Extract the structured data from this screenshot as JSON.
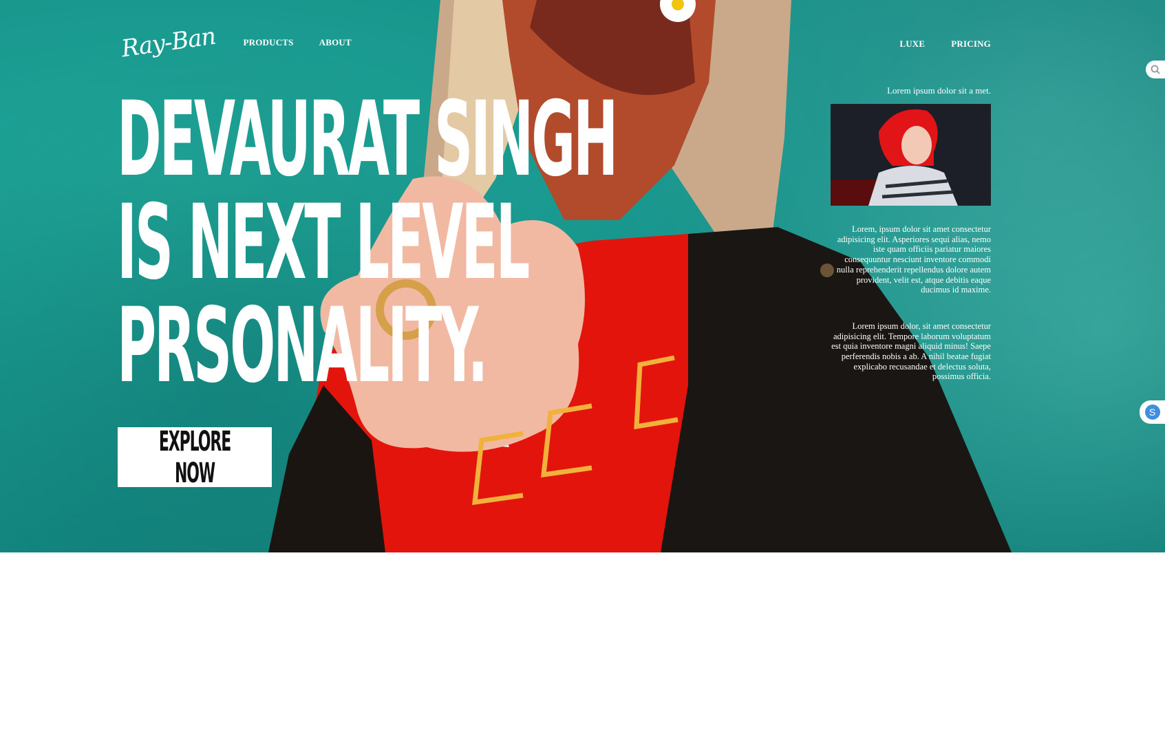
{
  "brand": {
    "logo_text": "Ray-Ban"
  },
  "nav": {
    "left": [
      {
        "label": "PRODUCTS"
      },
      {
        "label": "ABOUT"
      }
    ],
    "right": [
      {
        "label": "LUXE"
      },
      {
        "label": "PRICING"
      }
    ]
  },
  "hero": {
    "headline_lines": [
      "DEVAURAT SINGH",
      "IS NEXT LEVEL",
      "PRSONALITY."
    ],
    "cta_label": "EXPLORE NOW"
  },
  "side": {
    "caption": "Lorem ipsum dolor sit a met.",
    "paragraph_1": "Lorem, ipsum dolor sit amet consectetur adipisicing elit. Asperiores sequi alias, nemo iste quam officiis pariatur maiores consequuntur nesciunt inventore commodi nulla reprehenderit repellendus dolore autem provident, velit est, atque debitis eaque ducimus id maxime.",
    "paragraph_2": "Lorem ipsum dolor, sit amet consectetur adipisicing elit. Tempore laborum voluptatum est quia inventore magni aliquid minus! Saepe perferendis nobis a ab. A nihil beatae fugiat explicabo recusandae et delectus soluta, possimus officia."
  },
  "floating": {
    "s_badge": "S"
  },
  "colors": {
    "hero_teal": "#16928a",
    "shirt_red": "#e3140c",
    "jacket_black": "#1a1613",
    "text_white": "#ffffff"
  }
}
